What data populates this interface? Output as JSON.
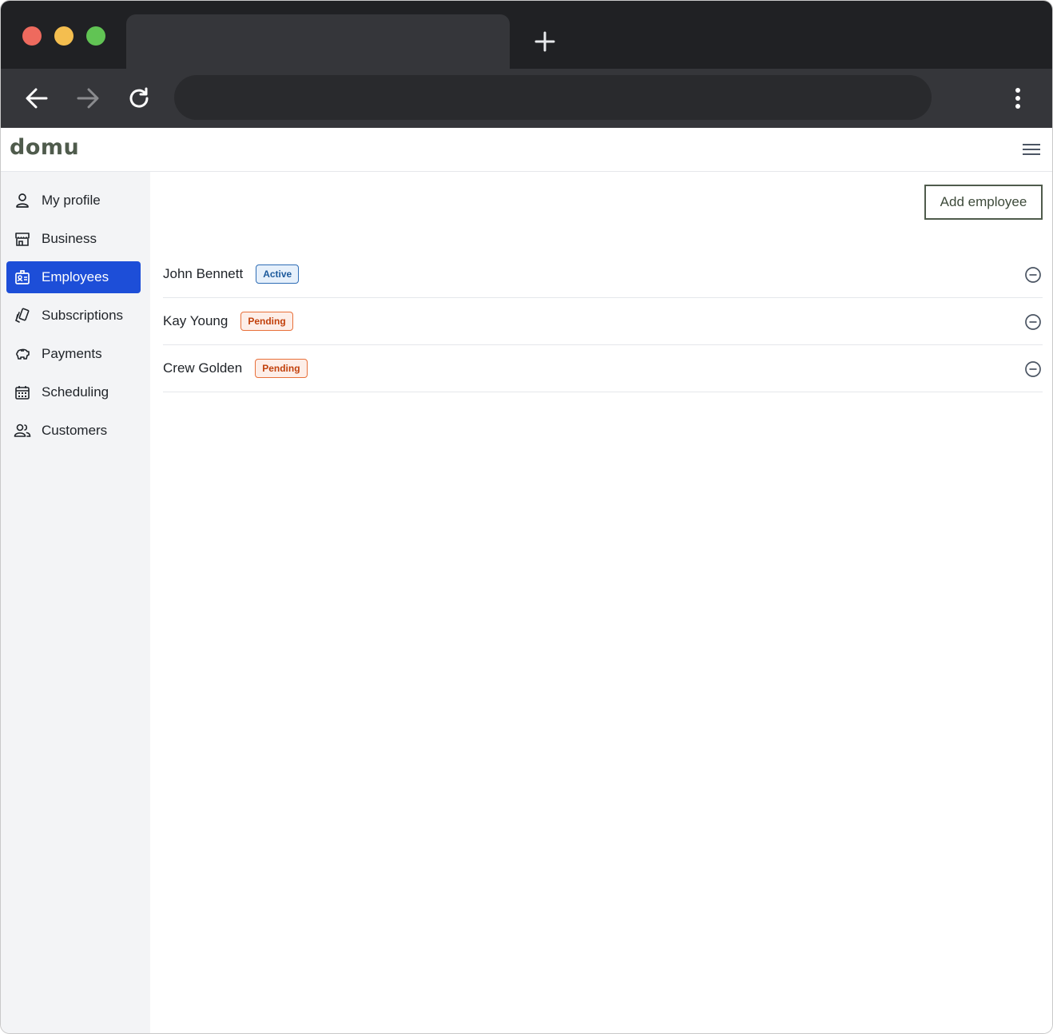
{
  "browser": {
    "tab_title": "",
    "address": "",
    "icons": {
      "new_tab": "plus-icon",
      "back": "arrow-left-icon",
      "forward": "arrow-right-icon",
      "reload": "reload-icon",
      "menu": "kebab-icon"
    },
    "colors": {
      "frame": "#202124",
      "tab": "#35363a",
      "address_bar": "#292a2d"
    }
  },
  "header": {
    "logo": "domu",
    "menu_icon": "hamburger-icon"
  },
  "sidebar": {
    "items": [
      {
        "label": "My profile",
        "icon": "user-icon",
        "active": false
      },
      {
        "label": "Business",
        "icon": "storefront-icon",
        "active": false
      },
      {
        "label": "Employees",
        "icon": "id-badge-icon",
        "active": true
      },
      {
        "label": "Subscriptions",
        "icon": "cards-icon",
        "active": false
      },
      {
        "label": "Payments",
        "icon": "piggy-bank-icon",
        "active": false
      },
      {
        "label": "Scheduling",
        "icon": "calendar-icon",
        "active": false
      },
      {
        "label": "Customers",
        "icon": "users-icon",
        "active": false
      }
    ],
    "active_color": "#1d4ed8"
  },
  "main": {
    "add_button_label": "Add employee",
    "employees": [
      {
        "name": "John Bennett",
        "status": "Active"
      },
      {
        "name": "Kay Young",
        "status": "Pending"
      },
      {
        "name": "Crew Golden",
        "status": "Pending"
      }
    ],
    "remove_icon": "minus-circle-icon",
    "status_colors": {
      "Active": "#2f6db5",
      "Pending": "#e8703a"
    }
  }
}
